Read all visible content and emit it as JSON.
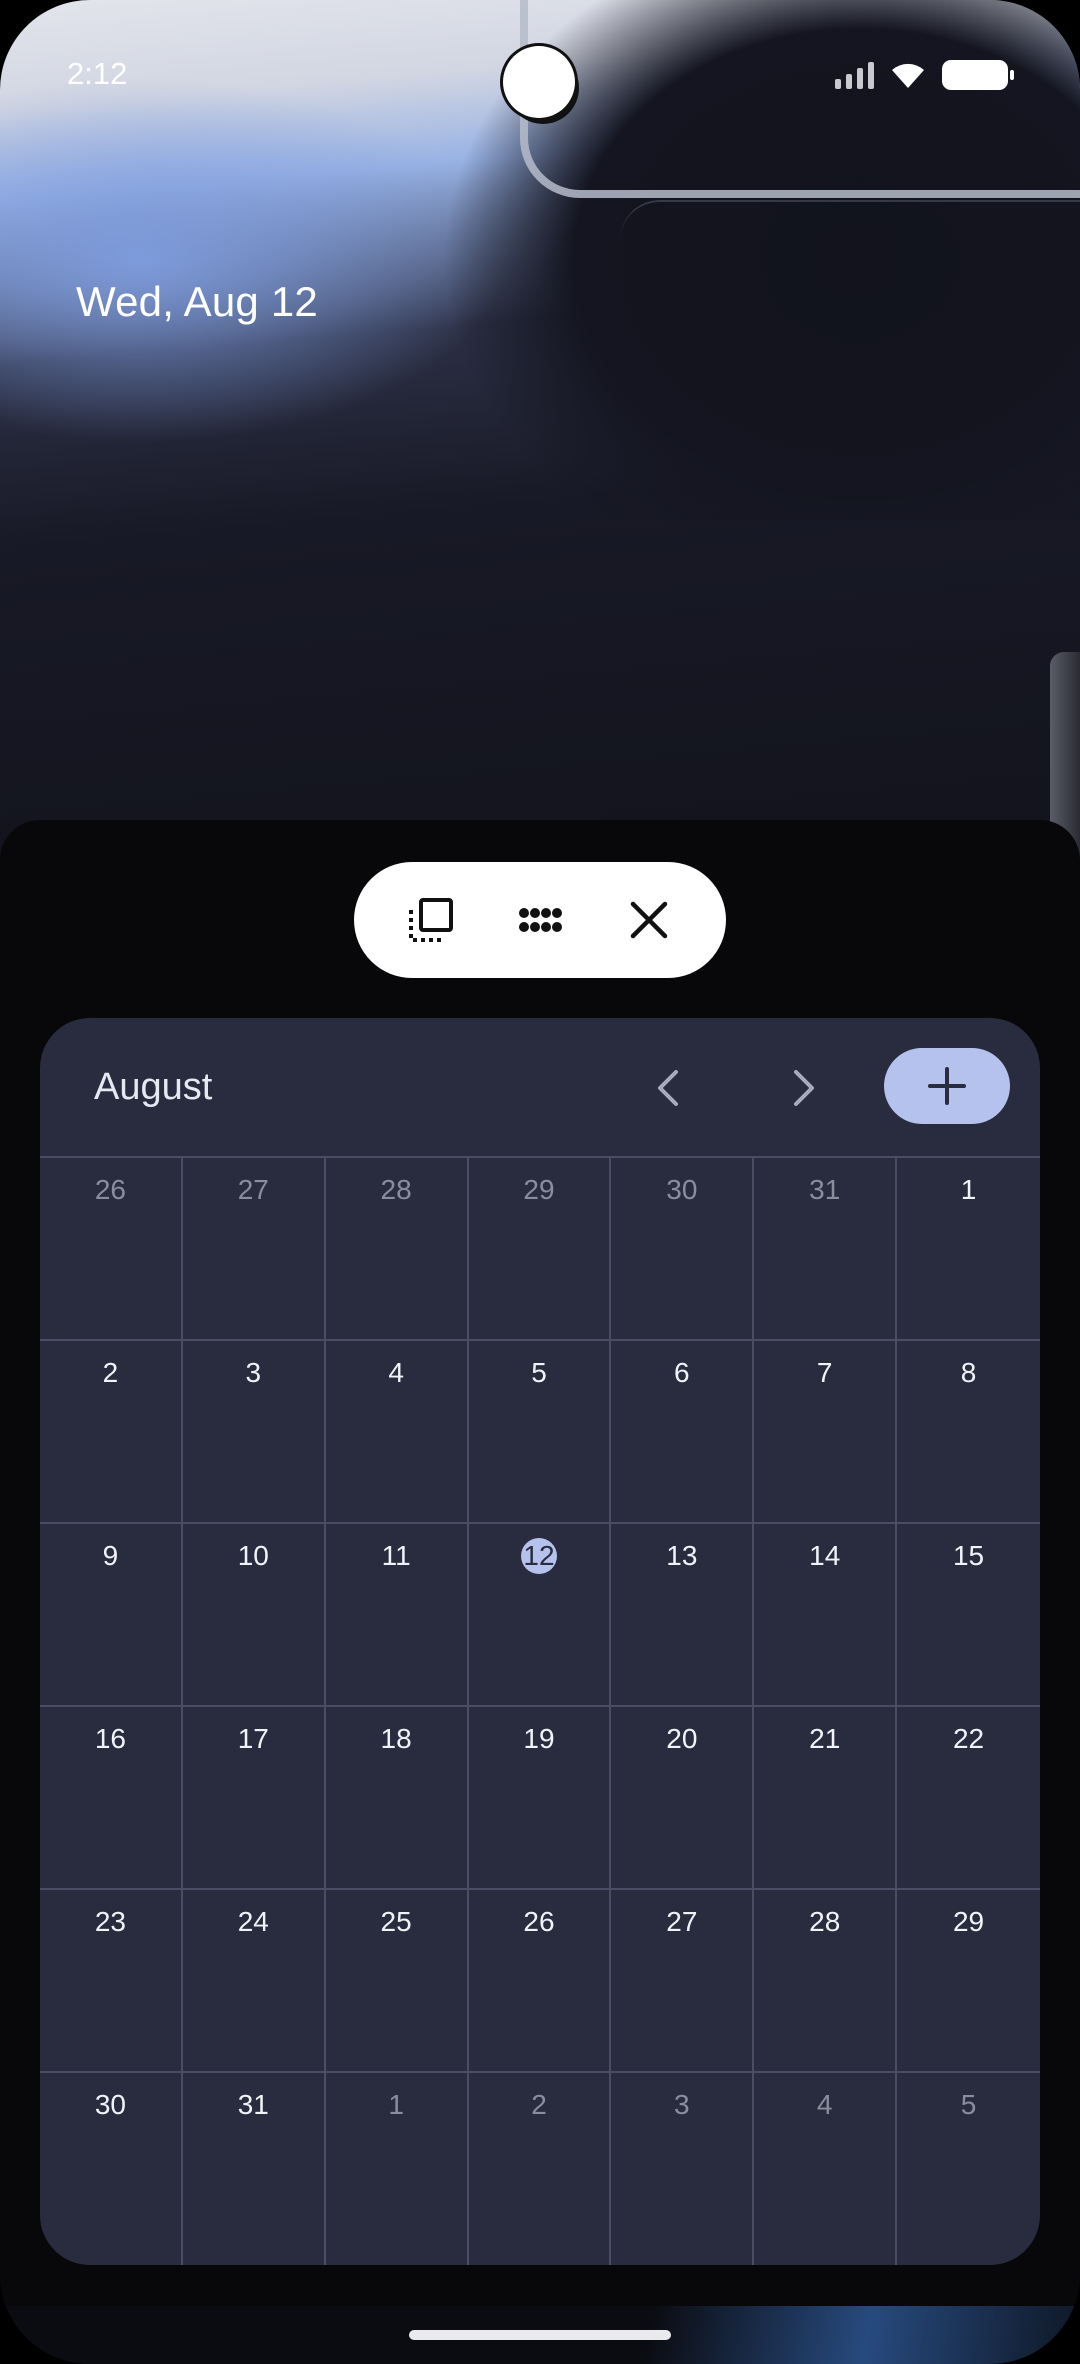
{
  "status_bar": {
    "time": "2:12"
  },
  "lockscreen": {
    "date": "Wed, Aug 12"
  },
  "toolbar": {
    "icons": [
      "dashed-square-icon",
      "apps-grid-icon",
      "close-icon"
    ]
  },
  "calendar": {
    "month": "August",
    "accent": "#b5c2ee",
    "today": "12",
    "weeks": [
      [
        {
          "d": "26",
          "dim": true
        },
        {
          "d": "27",
          "dim": true
        },
        {
          "d": "28",
          "dim": true
        },
        {
          "d": "29",
          "dim": true
        },
        {
          "d": "30",
          "dim": true
        },
        {
          "d": "31",
          "dim": true
        },
        {
          "d": "1"
        }
      ],
      [
        {
          "d": "2"
        },
        {
          "d": "3"
        },
        {
          "d": "4"
        },
        {
          "d": "5"
        },
        {
          "d": "6"
        },
        {
          "d": "7"
        },
        {
          "d": "8"
        }
      ],
      [
        {
          "d": "9"
        },
        {
          "d": "10"
        },
        {
          "d": "11"
        },
        {
          "d": "12",
          "today": true
        },
        {
          "d": "13"
        },
        {
          "d": "14"
        },
        {
          "d": "15"
        }
      ],
      [
        {
          "d": "16"
        },
        {
          "d": "17"
        },
        {
          "d": "18"
        },
        {
          "d": "19"
        },
        {
          "d": "20"
        },
        {
          "d": "21"
        },
        {
          "d": "22"
        }
      ],
      [
        {
          "d": "23"
        },
        {
          "d": "24"
        },
        {
          "d": "25"
        },
        {
          "d": "26"
        },
        {
          "d": "27"
        },
        {
          "d": "28"
        },
        {
          "d": "29"
        }
      ],
      [
        {
          "d": "30"
        },
        {
          "d": "31"
        },
        {
          "d": "1",
          "dim": true
        },
        {
          "d": "2",
          "dim": true
        },
        {
          "d": "3",
          "dim": true
        },
        {
          "d": "4",
          "dim": true
        },
        {
          "d": "5",
          "dim": true
        }
      ]
    ]
  }
}
